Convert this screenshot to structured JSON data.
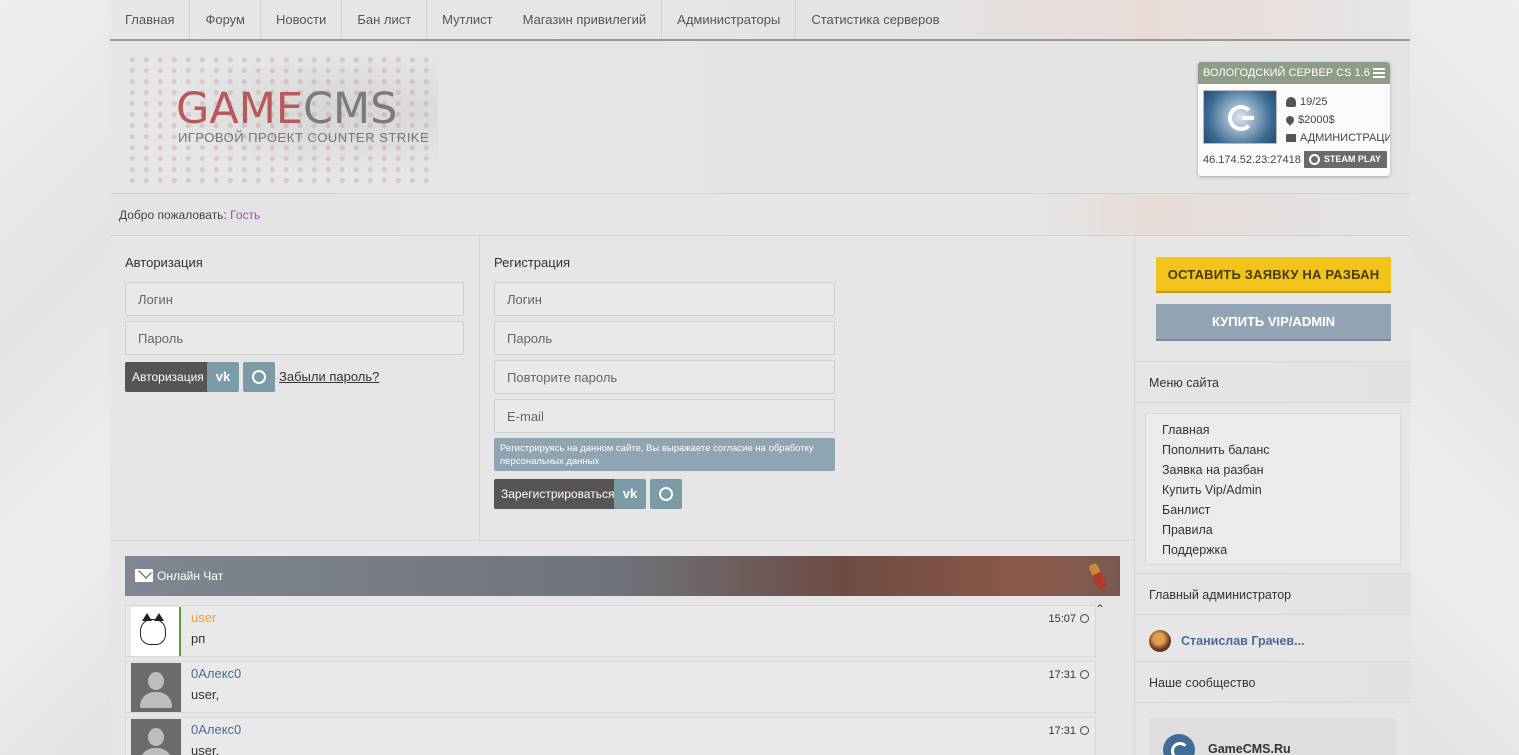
{
  "nav": {
    "items": [
      "Главная",
      "Форум",
      "Новости",
      "Бан лист",
      "Мутлист",
      "Магазин привилегий",
      "Администраторы",
      "Статистика серверов"
    ]
  },
  "logo": {
    "game": "GAME",
    "cms": "CMS",
    "subtitle": "ИГРОВОЙ ПРОЕКТ COUNTER STRIKE"
  },
  "server": {
    "title": "ВОЛОГОДСКИЙ СЕРВЕР CS 1.6",
    "players": "19/25",
    "map": "$2000$",
    "admin": "АДМИНИСТРАЦИЯ",
    "ip": "46.174.52.23:27418",
    "steam_label": "STEAM PLAY",
    "accent": "#8f9c88"
  },
  "welcome": {
    "prefix": "Добро пожаловать:",
    "guest": "Гость"
  },
  "auth": {
    "title": "Авторизация",
    "login_placeholder": "Логин",
    "password_placeholder": "Пароль",
    "submit": "Авторизация",
    "vk_label": "vk",
    "forgot": "Забыли пароль?"
  },
  "register": {
    "title": "Регистрация",
    "login_placeholder": "Логин",
    "password_placeholder": "Пароль",
    "repeat_placeholder": "Повторите пароль",
    "email_placeholder": "E-mail",
    "consent": "Регистрируясь на данном сайте, Вы выражаете согласие на обработку персональных данных",
    "submit": "Зарегистрироваться",
    "vk_label": "vk"
  },
  "chat": {
    "title": "Онлайн Чат",
    "messages": [
      {
        "name": "user",
        "text": "рп",
        "time": "15:07"
      },
      {
        "name": "0Алекс0",
        "text": "user,",
        "time": "17:31"
      },
      {
        "name": "0Алекс0",
        "text": "user,",
        "time": "17:31"
      }
    ]
  },
  "sidebar": {
    "unban_button": "ОСТАВИТЬ ЗАЯВКУ НА РАЗБАН",
    "vip_button": "КУПИТЬ VIP/ADMIN",
    "menu_title": "Меню сайта",
    "menu_items": [
      "Главная",
      "Пополнить баланс",
      "Заявка на разбан",
      "Купить Vip/Admin",
      "Банлист",
      "Правила",
      "Поддержка"
    ],
    "admin_title": "Главный администратор",
    "admin_name": "Станислав Грачев...",
    "community_title": "Наше сообщество",
    "community_name": "GameCMS.Ru"
  },
  "colors": {
    "unban": "#f2c31b",
    "vip": "#93a4b5",
    "link": "#4b6a9a",
    "guest": "#a24fa9"
  }
}
